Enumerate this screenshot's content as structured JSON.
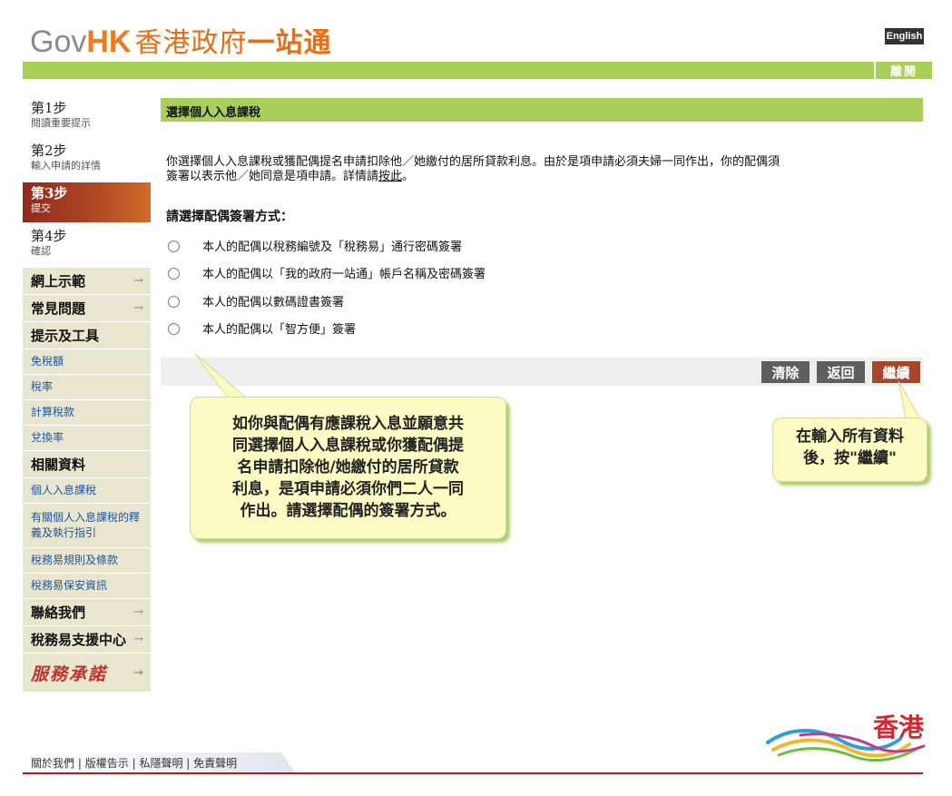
{
  "header": {
    "logo_gov": "Gov",
    "logo_hk": "HK",
    "logo_cn1": "香港政府",
    "logo_cn2": "一站通",
    "english_label": "English",
    "leave_label": "離開"
  },
  "sidebar": {
    "steps": [
      {
        "title": "第1步",
        "sub": "閱讀重要提示"
      },
      {
        "title": "第2步",
        "sub": "輸入申請的詳情"
      },
      {
        "title": "第3步",
        "sub": "提交"
      },
      {
        "title": "第4步",
        "sub": "確認"
      }
    ],
    "demo": "網上示範",
    "faq": "常見問題",
    "tips": "提示及工具",
    "tips_links": [
      "免稅額",
      "稅率",
      "計算稅款",
      "兌換率"
    ],
    "related": "相關資料",
    "related_links": [
      "個人入息課稅",
      "有關個人入息課稅的釋義及執行指引",
      "稅務易規則及條款",
      "稅務易保安資訊"
    ],
    "contact": "聯絡我們",
    "support": "稅務易支援中心",
    "service_pledge": "服務承諾"
  },
  "main": {
    "title": "選擇個人入息課稅",
    "intro_line1": "你選擇個人入息課稅或獲配偶提名申請扣除他／她繳付的居所貸款利息。由於是項申請必須夫婦一同作出，你的配偶須",
    "intro_line2_a": "簽署以表示他／她同意是項申請。詳情請",
    "intro_link": "按此",
    "intro_line2_b": "。",
    "options_title": "請選擇配偶簽署方式：",
    "options": [
      "本人的配偶以稅務編號及「稅務易」通行密碼簽署",
      "本人的配偶以「我的政府一站通」帳戶名稱及密碼簽署",
      "本人的配偶以數碼證書簽署",
      "本人的配偶以「智方便」簽署"
    ],
    "buttons": {
      "clear": "清除",
      "back": "返回",
      "next": "繼續"
    }
  },
  "callouts": {
    "left_lines": [
      "如你與配偶有應課稅入息並願意共",
      "同選擇個人入息課稅或你獲配偶提",
      "名申請扣除他/她繳付的居所貸款",
      "利息，是項申請必須你們二人一同",
      "作出。請選擇配偶的簽署方式。"
    ],
    "right_lines": [
      "在輸入所有資料",
      "後，按\"繼續\""
    ]
  },
  "footer": {
    "links": [
      "關於我們",
      "版權告示",
      "私隱聲明",
      "免責聲明"
    ],
    "separator": "|",
    "brand": "香港"
  }
}
